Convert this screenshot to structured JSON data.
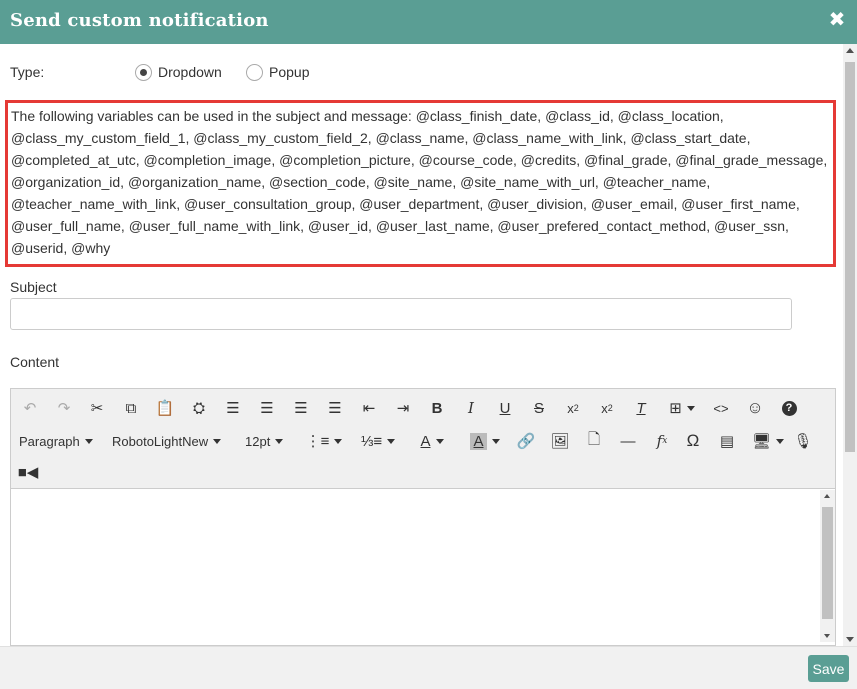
{
  "dialog": {
    "title": "Send custom notification",
    "close_glyph": "✖"
  },
  "type_row": {
    "label": "Type:",
    "options": [
      {
        "label": "Dropdown",
        "selected": true
      },
      {
        "label": "Popup",
        "selected": false
      }
    ]
  },
  "variables_text": "The following variables can be used in the subject and message: @class_finish_date, @class_id, @class_location, @class_my_custom_field_1, @class_my_custom_field_2, @class_name, @class_name_with_link, @class_start_date, @completed_at_utc, @completion_image, @completion_picture, @course_code, @credits, @final_grade, @final_grade_message, @organization_id, @organization_name, @section_code, @site_name, @site_name_with_url, @teacher_name, @teacher_name_with_link, @user_consultation_group, @user_department, @user_division, @user_email, @user_first_name, @user_full_name, @user_full_name_with_link, @user_id, @user_last_name, @user_prefered_contact_method, @user_ssn, @userid, @why",
  "subject": {
    "label": "Subject",
    "value": ""
  },
  "content": {
    "label": "Content",
    "toolbar": {
      "format_label": "Paragraph",
      "font_label": "RobotoLightNew",
      "size_label": "12pt"
    }
  },
  "footer": {
    "save_label": "Save"
  },
  "colors": {
    "accent": "#5a9e94",
    "highlight_border": "#e53935"
  }
}
